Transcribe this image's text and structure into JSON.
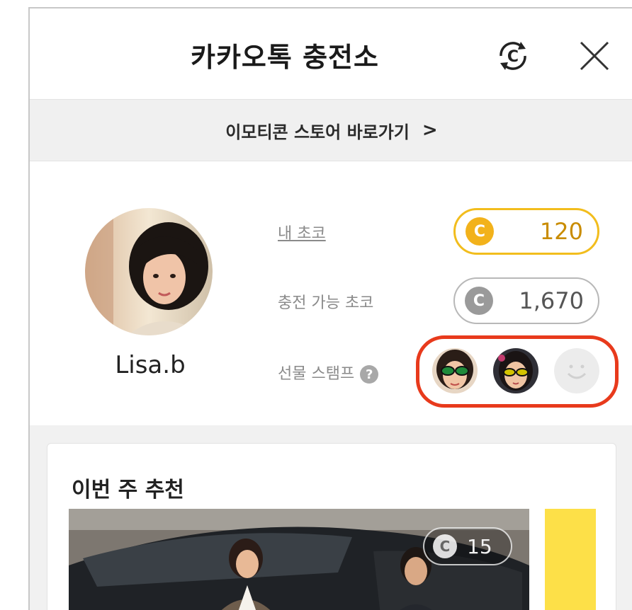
{
  "header": {
    "title": "카카오톡 충전소",
    "refresh_icon": "refresh-coin-icon",
    "close_icon": "close-icon"
  },
  "store_link": {
    "label": "이모티콘 스토어 바로가기",
    "chevron": ">"
  },
  "profile": {
    "username": "Lisa.b",
    "my_choco": {
      "label": "내 초코",
      "value": "120",
      "coin_glyph": "C"
    },
    "chargeable_choco": {
      "label": "충전 가능 초코",
      "value": "1,670",
      "coin_glyph": "C"
    },
    "gift_stamp": {
      "label": "선물 스탬프",
      "help_glyph": "?",
      "collected": 2,
      "total": 3
    }
  },
  "recommendation": {
    "title": "이번 주 추천",
    "price": "15",
    "coin_glyph": "C"
  },
  "colors": {
    "accent_yellow": "#f2b21b",
    "highlight_red": "#e83a1c",
    "promo_yellow": "#fde048"
  }
}
